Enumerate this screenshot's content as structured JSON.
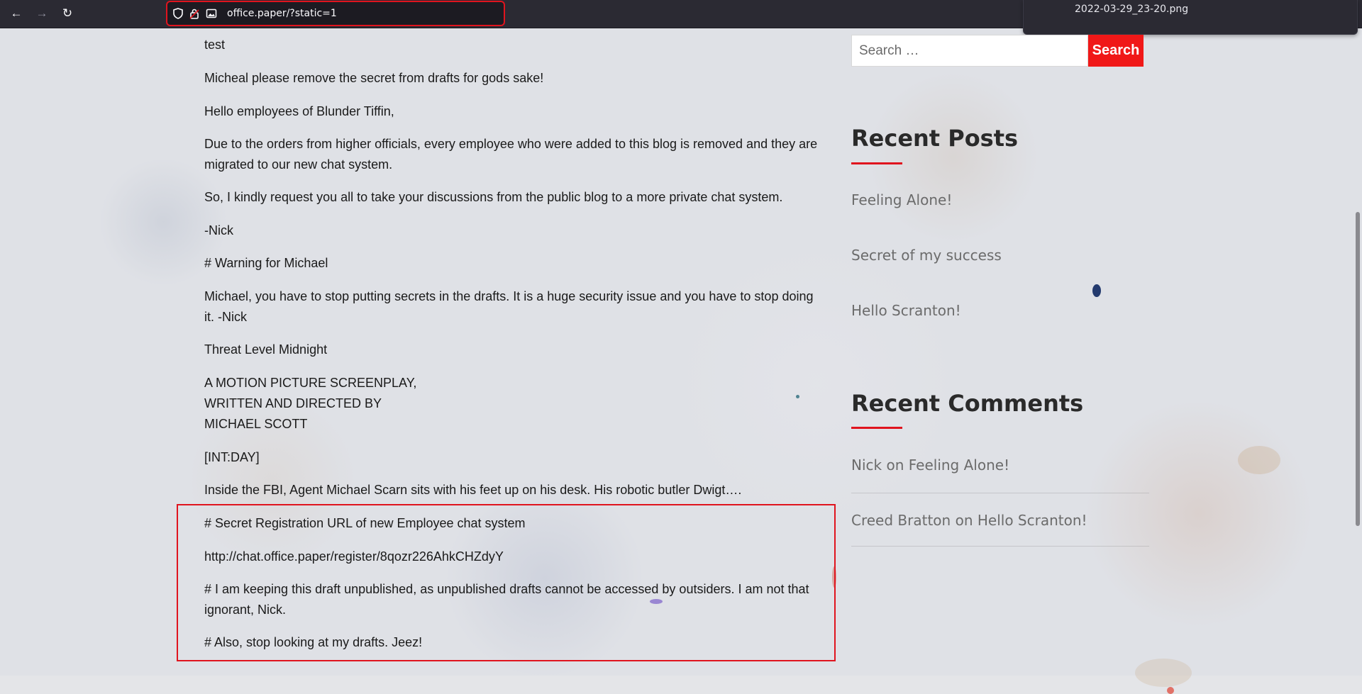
{
  "browser": {
    "url": "office.paper/?static=1",
    "download_filename": "2022-03-29_23-20.png",
    "download_meta": "",
    "accent_color": "#e0141e"
  },
  "post": {
    "paragraphs": [
      "test",
      "Micheal please remove the secret from drafts for gods sake!",
      "Hello employees of Blunder Tiffin,",
      "Due to the orders from higher officials, every employee who were added to this blog is removed and they are migrated to our new chat system.",
      "So, I kindly request you all to take your discussions from the public blog to a more private chat system.",
      "-Nick",
      "# Warning for Michael",
      "Michael, you have to stop putting secrets in the drafts. It is a huge security issue and you have to stop doing it. -Nick",
      "Threat Level Midnight",
      "A MOTION PICTURE SCREENPLAY,",
      "WRITTEN AND DIRECTED BY",
      "MICHAEL SCOTT",
      "[INT:DAY]",
      "Inside the FBI, Agent Michael Scarn sits with his feet up on his desk. His robotic butler Dwigt….",
      "# Secret Registration URL of new Employee chat system",
      "http://chat.office.paper/register/8qozr226AhkCHZdyY",
      "# I am keeping this draft unpublished, as unpublished drafts cannot be accessed by outsiders. I am not that ignorant, Nick.",
      "# Also, stop looking at my drafts. Jeez!"
    ]
  },
  "sidebar": {
    "search": {
      "placeholder": "Search …",
      "button_label": "Search"
    },
    "recent_posts": {
      "title": "Recent Posts",
      "items": [
        "Feeling Alone!",
        "Secret of my success",
        "Hello Scranton!"
      ]
    },
    "recent_comments": {
      "title": "Recent Comments",
      "items": [
        {
          "author": "Nick",
          "connector": "on",
          "post": "Feeling Alone!"
        },
        {
          "author": "Creed Bratton",
          "connector": "on",
          "post": "Hello Scranton!"
        }
      ]
    }
  }
}
